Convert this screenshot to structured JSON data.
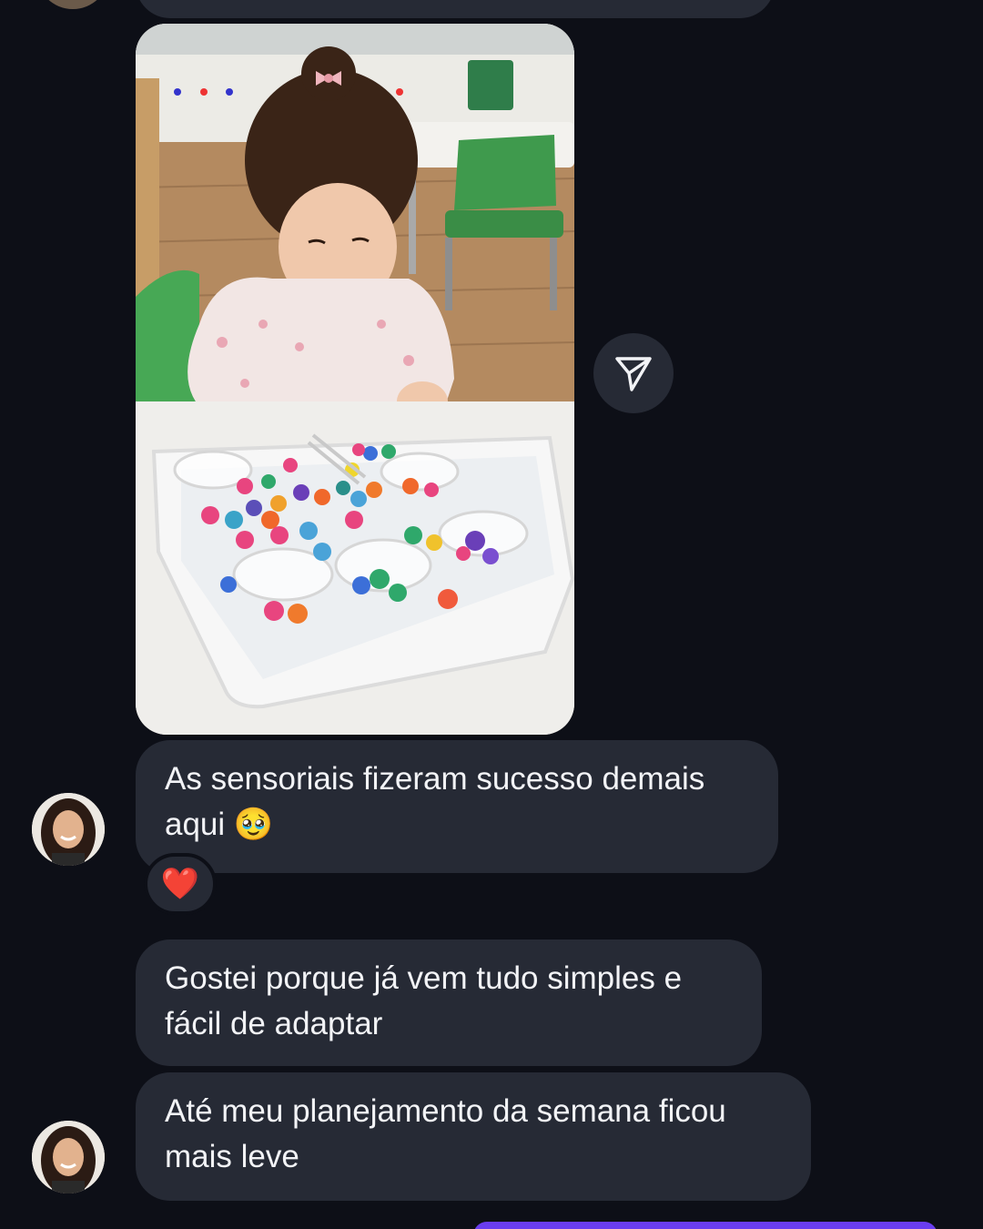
{
  "colors": {
    "background": "#0d0f17",
    "bubble": "#262a35",
    "text": "#f2f3f6",
    "outgoing_accent": "#6a3df0"
  },
  "photo": {
    "alt_icon": "photo-thumbnail"
  },
  "share_button": {
    "icon": "send-icon"
  },
  "messages": [
    {
      "text": "As sensoriais fizeram sucesso demais\naqui 🥹",
      "reaction": "❤️"
    },
    {
      "text": "Gostei porque já vem tudo simples e\nfácil de adaptar"
    },
    {
      "text": "Até meu planejamento da semana ficou\nmais leve"
    }
  ]
}
